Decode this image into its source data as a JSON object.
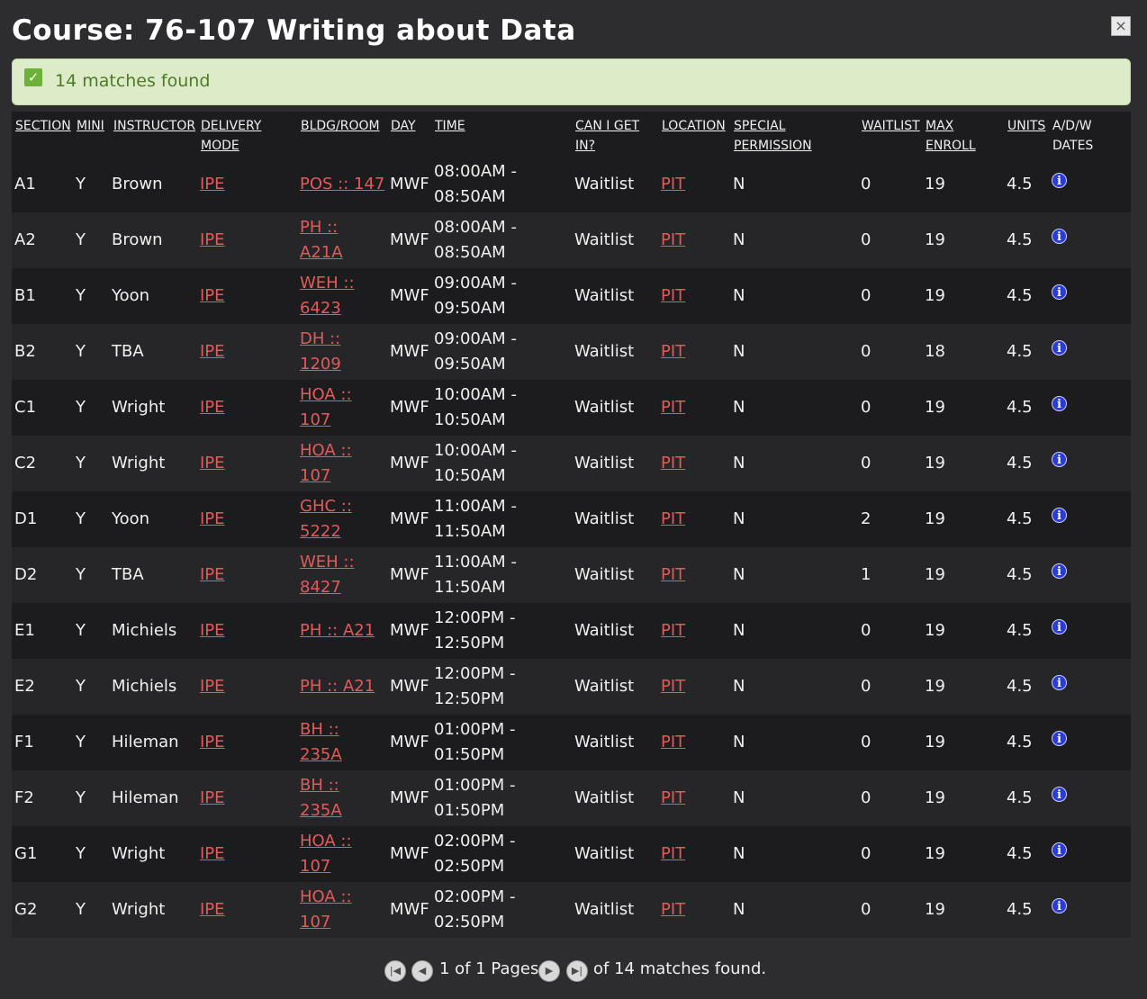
{
  "title": "Course: 76-107 Writing about Data",
  "close_label": "×",
  "matches_banner": "14 matches found",
  "columns": {
    "section": "SECTION",
    "mini": "MINI",
    "instructor": "INSTRUCTOR",
    "delivery_mode": "DELIVERY MODE",
    "bldg_room": "BLDG/ROOM",
    "day": "DAY",
    "time": "TIME",
    "can_i_get_in": "CAN I GET IN?",
    "location": "LOCATION",
    "special_permission": "SPECIAL PERMISSION",
    "waitlist": "WAITLIST",
    "max_enroll": "MAX ENROLL",
    "units": "UNITS",
    "adw_dates": "A/D/W DATES"
  },
  "rows": [
    {
      "section": "A1",
      "mini": "Y",
      "instructor": "Brown",
      "delivery": "IPE",
      "room": "POS :: 147",
      "day": "MWF",
      "time": "08:00AM - 08:50AM",
      "status": "Waitlist",
      "location": "PIT",
      "special": "N",
      "waitlist": "0",
      "max_enroll": "19",
      "units": "4.5"
    },
    {
      "section": "A2",
      "mini": "Y",
      "instructor": "Brown",
      "delivery": "IPE",
      "room": "PH :: A21A",
      "day": "MWF",
      "time": "08:00AM - 08:50AM",
      "status": "Waitlist",
      "location": "PIT",
      "special": "N",
      "waitlist": "0",
      "max_enroll": "19",
      "units": "4.5"
    },
    {
      "section": "B1",
      "mini": "Y",
      "instructor": "Yoon",
      "delivery": "IPE",
      "room": "WEH :: 6423",
      "day": "MWF",
      "time": "09:00AM - 09:50AM",
      "status": "Waitlist",
      "location": "PIT",
      "special": "N",
      "waitlist": "0",
      "max_enroll": "19",
      "units": "4.5"
    },
    {
      "section": "B2",
      "mini": "Y",
      "instructor": "TBA",
      "delivery": "IPE",
      "room": "DH :: 1209",
      "day": "MWF",
      "time": "09:00AM - 09:50AM",
      "status": "Waitlist",
      "location": "PIT",
      "special": "N",
      "waitlist": "0",
      "max_enroll": "18",
      "units": "4.5"
    },
    {
      "section": "C1",
      "mini": "Y",
      "instructor": "Wright",
      "delivery": "IPE",
      "room": "HOA :: 107",
      "day": "MWF",
      "time": "10:00AM - 10:50AM",
      "status": "Waitlist",
      "location": "PIT",
      "special": "N",
      "waitlist": "0",
      "max_enroll": "19",
      "units": "4.5"
    },
    {
      "section": "C2",
      "mini": "Y",
      "instructor": "Wright",
      "delivery": "IPE",
      "room": "HOA :: 107",
      "day": "MWF",
      "time": "10:00AM - 10:50AM",
      "status": "Waitlist",
      "location": "PIT",
      "special": "N",
      "waitlist": "0",
      "max_enroll": "19",
      "units": "4.5"
    },
    {
      "section": "D1",
      "mini": "Y",
      "instructor": "Yoon",
      "delivery": "IPE",
      "room": "GHC :: 5222",
      "day": "MWF",
      "time": "11:00AM - 11:50AM",
      "status": "Waitlist",
      "location": "PIT",
      "special": "N",
      "waitlist": "2",
      "max_enroll": "19",
      "units": "4.5"
    },
    {
      "section": "D2",
      "mini": "Y",
      "instructor": "TBA",
      "delivery": "IPE",
      "room": "WEH :: 8427",
      "day": "MWF",
      "time": "11:00AM - 11:50AM",
      "status": "Waitlist",
      "location": "PIT",
      "special": "N",
      "waitlist": "1",
      "max_enroll": "19",
      "units": "4.5"
    },
    {
      "section": "E1",
      "mini": "Y",
      "instructor": "Michiels",
      "delivery": "IPE",
      "room": "PH :: A21",
      "day": "MWF",
      "time": "12:00PM - 12:50PM",
      "status": "Waitlist",
      "location": "PIT",
      "special": "N",
      "waitlist": "0",
      "max_enroll": "19",
      "units": "4.5"
    },
    {
      "section": "E2",
      "mini": "Y",
      "instructor": "Michiels",
      "delivery": "IPE",
      "room": "PH :: A21",
      "day": "MWF",
      "time": "12:00PM - 12:50PM",
      "status": "Waitlist",
      "location": "PIT",
      "special": "N",
      "waitlist": "0",
      "max_enroll": "19",
      "units": "4.5"
    },
    {
      "section": "F1",
      "mini": "Y",
      "instructor": "Hileman",
      "delivery": "IPE",
      "room": "BH :: 235A",
      "day": "MWF",
      "time": "01:00PM - 01:50PM",
      "status": "Waitlist",
      "location": "PIT",
      "special": "N",
      "waitlist": "0",
      "max_enroll": "19",
      "units": "4.5"
    },
    {
      "section": "F2",
      "mini": "Y",
      "instructor": "Hileman",
      "delivery": "IPE",
      "room": "BH :: 235A",
      "day": "MWF",
      "time": "01:00PM - 01:50PM",
      "status": "Waitlist",
      "location": "PIT",
      "special": "N",
      "waitlist": "0",
      "max_enroll": "19",
      "units": "4.5"
    },
    {
      "section": "G1",
      "mini": "Y",
      "instructor": "Wright",
      "delivery": "IPE",
      "room": "HOA :: 107",
      "day": "MWF",
      "time": "02:00PM - 02:50PM",
      "status": "Waitlist",
      "location": "PIT",
      "special": "N",
      "waitlist": "0",
      "max_enroll": "19",
      "units": "4.5"
    },
    {
      "section": "G2",
      "mini": "Y",
      "instructor": "Wright",
      "delivery": "IPE",
      "room": "HOA :: 107",
      "day": "MWF",
      "time": "02:00PM - 02:50PM",
      "status": "Waitlist",
      "location": "PIT",
      "special": "N",
      "waitlist": "0",
      "max_enroll": "19",
      "units": "4.5"
    }
  ],
  "info_glyph": "i",
  "pager": {
    "page_text": "1 of 1 Pages",
    "summary": "of 14 matches found."
  },
  "colors": {
    "link": "#e35a5a",
    "banner_bg": "#ddecc8",
    "banner_text": "#4f7a25",
    "info_icon": "#2b3bd6"
  },
  "icons": {
    "close": "close-icon",
    "check": "check-icon",
    "info": "info-icon",
    "first": "first-page-icon",
    "prev": "prev-page-icon",
    "next": "next-page-icon",
    "last": "last-page-icon"
  }
}
